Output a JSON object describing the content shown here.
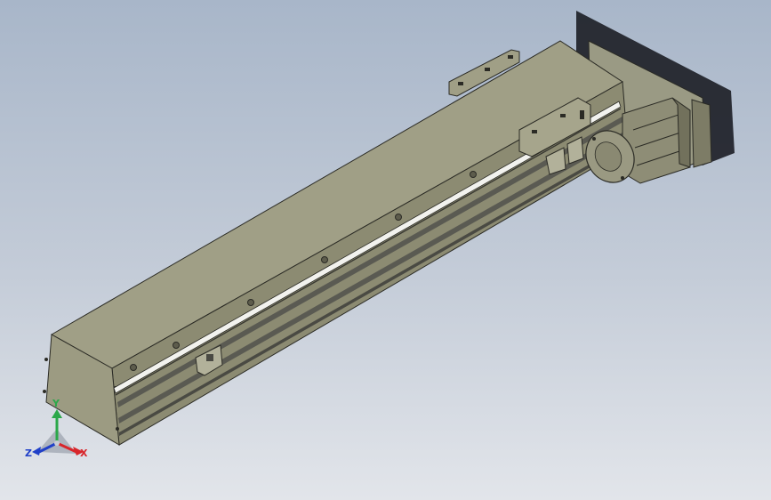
{
  "viewport": {
    "background_top": "#a8b6c9",
    "background_bottom": "#e2e5ea"
  },
  "model": {
    "body_color": "#8c8b72",
    "body_top_color": "#a09f86",
    "rail_color": "#f2f2ee",
    "profile_color": "#5a5a52",
    "motor_color": "#8e8d76",
    "edge_color": "#2b2b25"
  },
  "triad": {
    "x_label": "X",
    "y_label": "Y",
    "z_label": "Z",
    "x_color": "#d8262b",
    "y_color": "#2ba84a",
    "z_color": "#2040c8"
  }
}
